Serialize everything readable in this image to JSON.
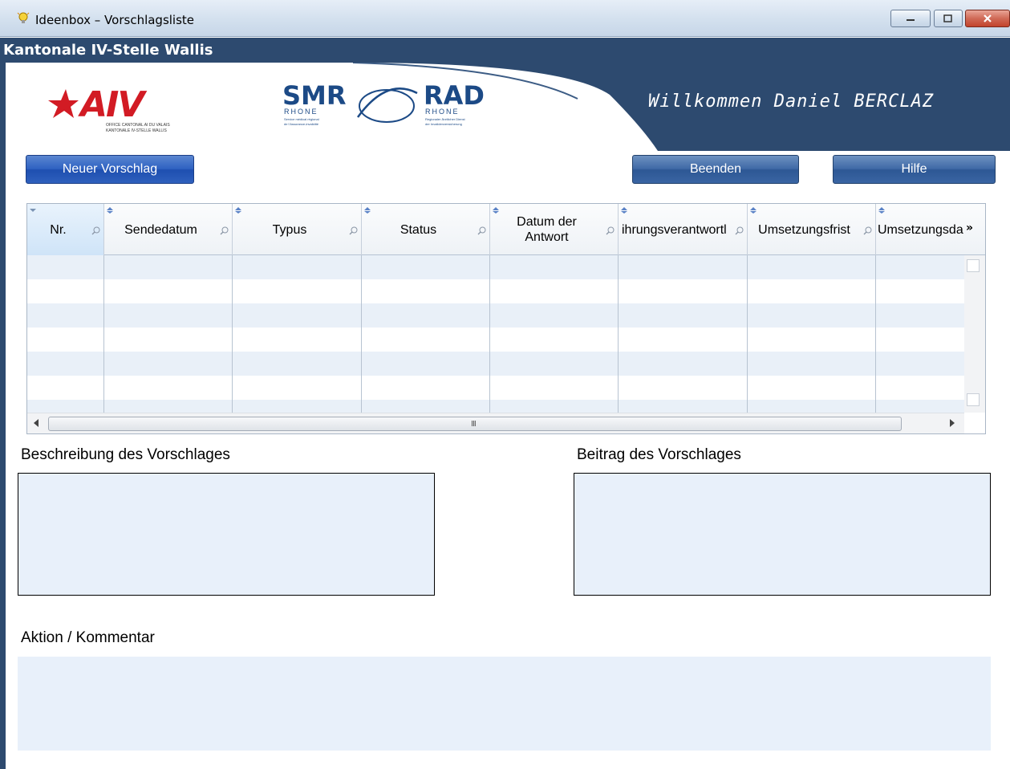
{
  "window": {
    "title": "Ideenbox – Vorschlagsliste",
    "icon": "lightbulb-icon"
  },
  "band": {
    "text": "Kantonale IV-Stelle Wallis"
  },
  "header": {
    "welcome": "Willkommen Daniel BERCLAZ",
    "logos": {
      "aiv": {
        "mark": "AIV",
        "line1": "OFFICE CANTONAL AI DU VALAIS",
        "line2": "KANTONALE IV-STELLE WALLIS"
      },
      "smr": {
        "mark": "SMR",
        "rhone": "RHONE",
        "line1": "Service médical régional",
        "line2": "de l'Assurance-invalidité"
      },
      "rad": {
        "mark": "RAD",
        "rhone": "RHONE",
        "line1": "Regionaler Ärztlicher Dienst",
        "line2": "der Invalidenversicherung"
      }
    }
  },
  "toolbar": {
    "new_label": "Neuer Vorschlag",
    "end_label": "Beenden",
    "help_label": "Hilfe"
  },
  "grid": {
    "columns": [
      "Nr.",
      "Sendedatum",
      "Typus",
      "Status",
      "Datum der Antwort",
      "ihrungsverantwortl",
      "Umsetzungsfrist",
      "Umsetzungsda"
    ],
    "more_glyph": "»",
    "hscroll_grip": "III",
    "rows": []
  },
  "panels": {
    "description_label": "Beschreibung des Vorschlages",
    "contribution_label": "Beitrag des Vorschlages",
    "action_label": "Aktion / Kommentar",
    "description_value": "",
    "contribution_value": "",
    "action_value": ""
  },
  "colors": {
    "band": "#2d4a6f",
    "button": "#3f69a6",
    "row_alt": "#e9f0f8",
    "textarea": "#e8f0fa",
    "aiv_red": "#d21b24",
    "smr_blue": "#1c4a86"
  }
}
